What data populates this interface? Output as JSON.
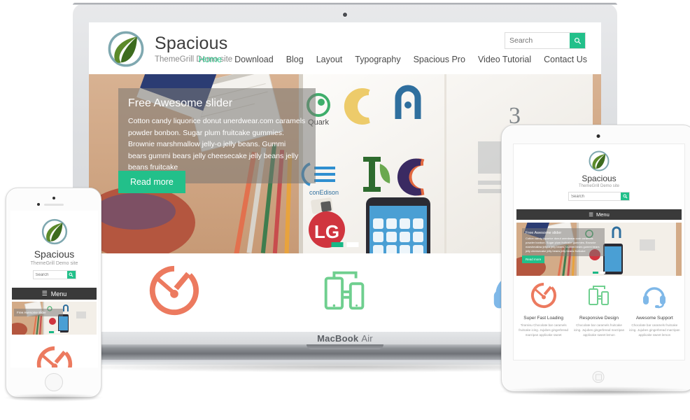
{
  "site": {
    "brand_name": "Spacious",
    "tagline": "ThemeGrill Demo site",
    "logo_icon": "leaf-logo-icon"
  },
  "search": {
    "placeholder": "Search",
    "value": "",
    "button_icon": "search-icon"
  },
  "nav": {
    "items": [
      {
        "label": "Home",
        "active": true
      },
      {
        "label": "Download",
        "active": false
      },
      {
        "label": "Blog",
        "active": false
      },
      {
        "label": "Layout",
        "active": false
      },
      {
        "label": "Typography",
        "active": false
      },
      {
        "label": "Spacious Pro",
        "active": false
      },
      {
        "label": "Video Tutorial",
        "active": false
      },
      {
        "label": "Contact Us",
        "active": false
      }
    ]
  },
  "slider": {
    "title": "Free Awesome slider",
    "body": "Cotton candy liquorice donut unerdwear.com caramels powder bonbon. Sugar plum fruitcake gummies. Brownie marshmallow jelly-o jelly beans. Gummi bears gummi bears jelly cheesecake jelly beans jelly beans fruitcake",
    "button_label": "Read more",
    "dots_total": 2,
    "dot_active_index": 0,
    "accent_color": "#22c08a"
  },
  "services": [
    {
      "title": "Super Fast Loading",
      "body": "Tiramisu Chocolate bar caramels fruitcake icing. Jujubes gingerbread marzipan applicake sweet",
      "icon": "speedometer-icon",
      "color": "#ec7a5f"
    },
    {
      "title": "Responsive Design",
      "body": "Chocolate bar caramels fruitcake icing. Jujubes gingerbread marzipan applicake sweet lemon",
      "icon": "responsive-devices-icon",
      "color": "#6fcf8f"
    },
    {
      "title": "Awesome Support",
      "body": "Chocolate bar caramels fruitcake icing. Jujubes gingerbread marzipan applicake sweet lemon",
      "icon": "headset-icon",
      "color": "#7fb8e8"
    }
  ],
  "mobile": {
    "menu_label": "Menu",
    "menu_icon": "hamburger-icon"
  },
  "devices": {
    "laptop_label_bold": "MacBook",
    "laptop_label_light": "Air",
    "laptop_camera": "webcam-icon",
    "tablet_camera": "front-camera-icon",
    "tablet_home": "home-button",
    "phone_home": "home-button",
    "phone_speaker": "earpiece-speaker",
    "phone_camera": "front-camera-icon"
  }
}
